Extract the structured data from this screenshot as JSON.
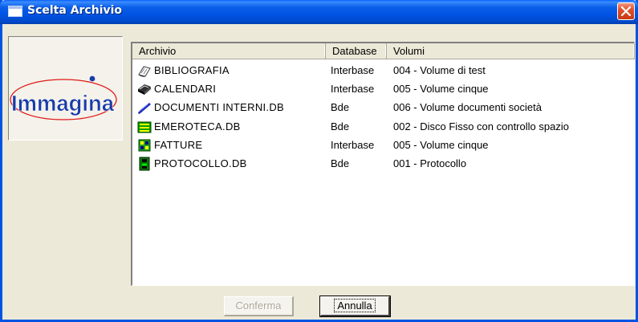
{
  "window": {
    "title": "Scelta Archivio",
    "title_bar_color": "#0054e3",
    "close_color": "#e0502a"
  },
  "logo": {
    "text": "Immagina",
    "text_color": "#1a3ca8",
    "ellipse_color": "#e01818",
    "dot_color": "#1a3ca8"
  },
  "list": {
    "columns": [
      "Archivio",
      "Database",
      "Volumi"
    ],
    "rows": [
      {
        "icon": "bibliography-icon",
        "name": "BIBLIOGRAFIA",
        "database": "Interbase",
        "volume": "004 - Volume di test"
      },
      {
        "icon": "calendar-icon",
        "name": "CALENDARI",
        "database": "Interbase",
        "volume": "005 - Volume cinque"
      },
      {
        "icon": "documents-icon",
        "name": "DOCUMENTI INTERNI.DB",
        "database": "Bde",
        "volume": "006 - Volume documenti società"
      },
      {
        "icon": "newspaper-icon",
        "name": "EMEROTECA.DB",
        "database": "Bde",
        "volume": "002 - Disco Fisso con controllo spazio"
      },
      {
        "icon": "invoices-icon",
        "name": "FATTURE",
        "database": "Interbase",
        "volume": "005 - Volume cinque"
      },
      {
        "icon": "protocol-icon",
        "name": "PROTOCOLLO.DB",
        "database": "Bde",
        "volume": "001 - Protocollo"
      }
    ]
  },
  "buttons": {
    "confirm_label": "Conferma",
    "cancel_label": "Annulla"
  }
}
